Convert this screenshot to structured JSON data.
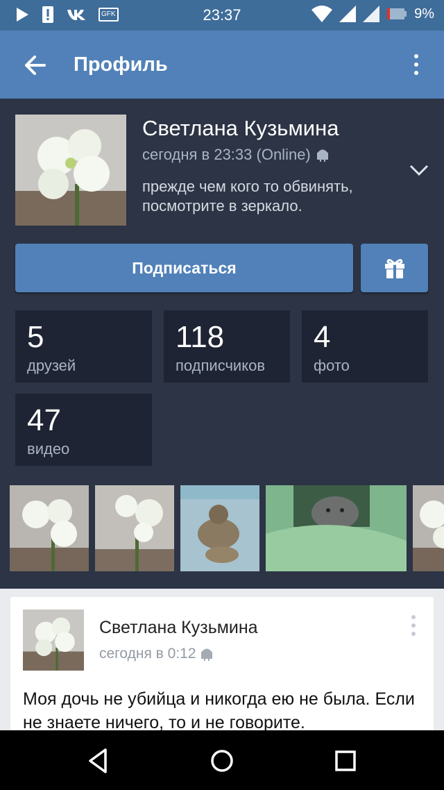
{
  "status_bar": {
    "time": "23:37",
    "battery": "9%",
    "carrier_badge": "GFK",
    "icons": [
      "play-icon",
      "alert-icon",
      "vk-icon",
      "gfk-icon",
      "wifi-icon",
      "signal-icon",
      "battery-icon"
    ]
  },
  "toolbar": {
    "title": "Профиль",
    "back_icon": "arrow-left-icon",
    "menu_icon": "more-vertical-icon"
  },
  "profile": {
    "name": "Светлана Кузьмина",
    "last_seen": "сегодня в 23:33 (Online)",
    "status": "прежде чем кого то обвинять, посмотрите в зеркало.",
    "subscribe_label": "Подписаться",
    "gift_icon": "gift-icon",
    "counters": [
      {
        "value": "5",
        "label": "друзей"
      },
      {
        "value": "118",
        "label": "подписчиков"
      },
      {
        "value": "4",
        "label": "фото"
      },
      {
        "value": "47",
        "label": "видео"
      }
    ]
  },
  "post": {
    "author": "Светлана Кузьмина",
    "time": "сегодня в 0:12",
    "text": "Моя дочь не убийца и никогда ею не была. Если не знаете ничего, то и не говорите."
  },
  "colors": {
    "status_bar": "#3f6d9a",
    "toolbar": "#5181b8",
    "profile_bg": "#2c3445",
    "counter_bg": "#1e2433",
    "accent_button": "#5181b8"
  }
}
